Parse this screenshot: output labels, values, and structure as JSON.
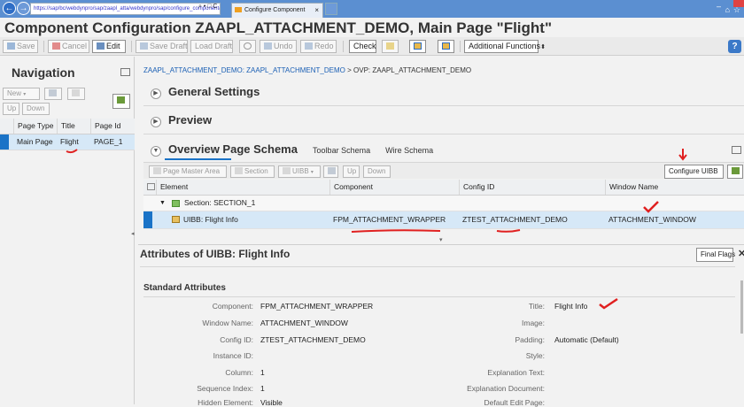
{
  "browser": {
    "address": "https://sap/bc/webdynpro/sap/zaapl_atta/webdynpro/sap/configure_component#",
    "address_controls": "⌕ • □ C",
    "tab_label": "Configure Component",
    "tab_close": "×",
    "back": "←",
    "forward": "→",
    "home": "⌂",
    "favorites": "☆",
    "minimize": "–"
  },
  "page_title": "Component Configuration ZAAPL_ATTACHMENT_DEMO, Main Page \"Flight\"",
  "toolbar": {
    "save": "Save",
    "cancel": "Cancel",
    "edit": "Edit",
    "save_draft": "Save Draft",
    "load_draft": "Load Draft",
    "undo": "Undo",
    "redo": "Redo",
    "check": "Check",
    "additional_functions": "Additional Functions",
    "dropdown_mark": "⬍",
    "help": "?"
  },
  "navigation": {
    "title": "Navigation",
    "new": "New",
    "up": "Up",
    "down": "Down",
    "columns": [
      "Page Type",
      "Title",
      "Page Id"
    ],
    "rows": [
      {
        "type": "Main Page",
        "title": "Flight",
        "id": "PAGE_1"
      }
    ]
  },
  "breadcrumb": {
    "link": "ZAAPL_ATTACHMENT_DEMO: ZAAPL_ATTACHMENT_DEMO",
    "separator": ">",
    "current": "OVP: ZAAPL_ATTACHMENT_DEMO"
  },
  "sections": {
    "general": "General Settings",
    "preview": "Preview",
    "schema": "Overview Page Schema",
    "toolbar_schema": "Toolbar Schema",
    "wire_schema": "Wire Schema"
  },
  "schema_toolbar": {
    "page_master_area": "Page Master Area",
    "section": "Section",
    "uibb": "UIBB",
    "up": "Up",
    "down": "Down",
    "configure_uibb": "Configure UIBB"
  },
  "schema_table": {
    "columns": [
      "Element",
      "Component",
      "Config ID",
      "Window Name"
    ],
    "section_row": "Section: SECTION_1",
    "uibb_row": {
      "element": "UIBB: Flight Info",
      "component": "FPM_ATTACHMENT_WRAPPER",
      "config_id": "ZTEST_ATTACHMENT_DEMO",
      "window": "ATTACHMENT_WINDOW"
    }
  },
  "attributes": {
    "title": "Attributes of UIBB: Flight Info",
    "final_flags": "Final Flags",
    "close": "✕",
    "standard": "Standard Attributes",
    "left": [
      {
        "label": "Component:",
        "value": "FPM_ATTACHMENT_WRAPPER"
      },
      {
        "label": "Window Name:",
        "value": "ATTACHMENT_WINDOW"
      },
      {
        "label": "Config ID:",
        "value": "ZTEST_ATTACHMENT_DEMO"
      },
      {
        "label": "Instance ID:",
        "value": ""
      },
      {
        "label": "Column:",
        "value": "1"
      },
      {
        "label": "Sequence Index:",
        "value": "1"
      },
      {
        "label": "Hidden Element:",
        "value": "Visible"
      }
    ],
    "right": [
      {
        "label": "Title:",
        "value": "Flight Info"
      },
      {
        "label": "Image:",
        "value": ""
      },
      {
        "label": "Padding:",
        "value": "Automatic (Default)"
      },
      {
        "label": "Style:",
        "value": ""
      },
      {
        "label": "Explanation Text:",
        "value": ""
      },
      {
        "label": "Explanation Document:",
        "value": ""
      },
      {
        "label": "Default Edit Page:",
        "value": ""
      }
    ]
  },
  "colors": {
    "accent": "#1a73c7",
    "selected_row": "#d6e8f7",
    "annotation_red": "#e02020"
  }
}
